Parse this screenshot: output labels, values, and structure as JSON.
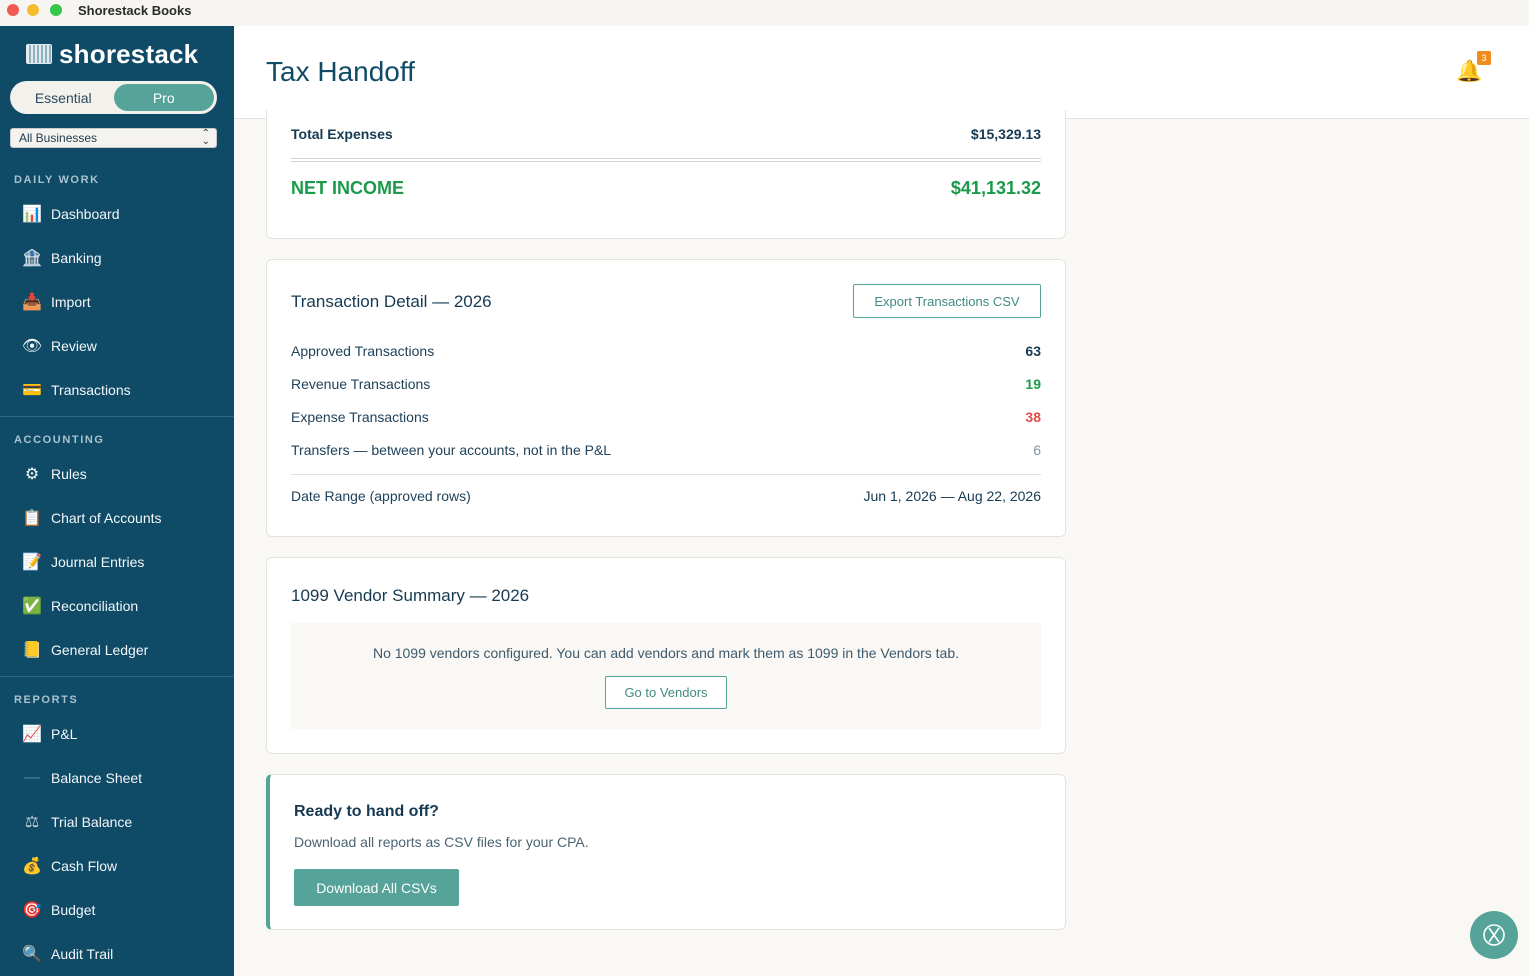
{
  "window": {
    "title": "Shorestack Books"
  },
  "sidebar": {
    "brand": "shorestack",
    "plans": [
      "Essential",
      "Pro"
    ],
    "business_select": "All Businesses",
    "sections": [
      {
        "title": "DAILY WORK",
        "items": [
          {
            "label": "Dashboard",
            "icon": "📊"
          },
          {
            "label": "Banking",
            "icon": "🏦"
          },
          {
            "label": "Import",
            "icon": "📥"
          },
          {
            "label": "Review",
            "icon": "👁"
          },
          {
            "label": "Transactions",
            "icon": "💳"
          }
        ]
      },
      {
        "title": "ACCOUNTING",
        "items": [
          {
            "label": "Rules",
            "icon": "⚙"
          },
          {
            "label": "Chart of Accounts",
            "icon": "📋"
          },
          {
            "label": "Journal Entries",
            "icon": "📝"
          },
          {
            "label": "Reconciliation",
            "icon": "✅"
          },
          {
            "label": "General Ledger",
            "icon": "📒"
          }
        ]
      },
      {
        "title": "REPORTS",
        "items": [
          {
            "label": "P&L",
            "icon": "📈"
          },
          {
            "label": "Balance Sheet",
            "icon": "—"
          },
          {
            "label": "Trial Balance",
            "icon": "⚖"
          },
          {
            "label": "Cash Flow",
            "icon": "💰"
          },
          {
            "label": "Budget",
            "icon": "🎯"
          },
          {
            "label": "Audit Trail",
            "icon": "🔍"
          }
        ]
      }
    ]
  },
  "header": {
    "title": "Tax Handoff",
    "notification_count": "3"
  },
  "summary": {
    "total_expenses_label": "Total Expenses",
    "total_expenses_value": "$15,329.13",
    "net_income_label": "NET INCOME",
    "net_income_value": "$41,131.32"
  },
  "transaction_detail": {
    "title": "Transaction Detail — 2026",
    "export_label": "Export Transactions CSV",
    "rows": [
      {
        "label": "Approved Transactions",
        "value": "63"
      },
      {
        "label": "Revenue Transactions",
        "value": "19"
      },
      {
        "label": "Expense Transactions",
        "value": "38"
      },
      {
        "label": "Transfers — between your accounts, not in the P&L",
        "value": "6"
      }
    ],
    "date_range_label": "Date Range (approved rows)",
    "date_range_value": "Jun 1, 2026 — Aug 22, 2026"
  },
  "vendor_summary": {
    "title": "1099 Vendor Summary — 2026",
    "empty_text": "No 1099 vendors configured. You can add vendors and mark them as 1099 in the Vendors tab.",
    "button_label": "Go to Vendors"
  },
  "handoff": {
    "title": "Ready to hand off?",
    "description": "Download all reports as CSV files for your CPA.",
    "button_label": "Download All CSVs"
  },
  "colors": {
    "sidebar": "#0f4a66",
    "accent": "#56a399",
    "positive": "#1a9a4a",
    "negative": "#e34b4b"
  }
}
